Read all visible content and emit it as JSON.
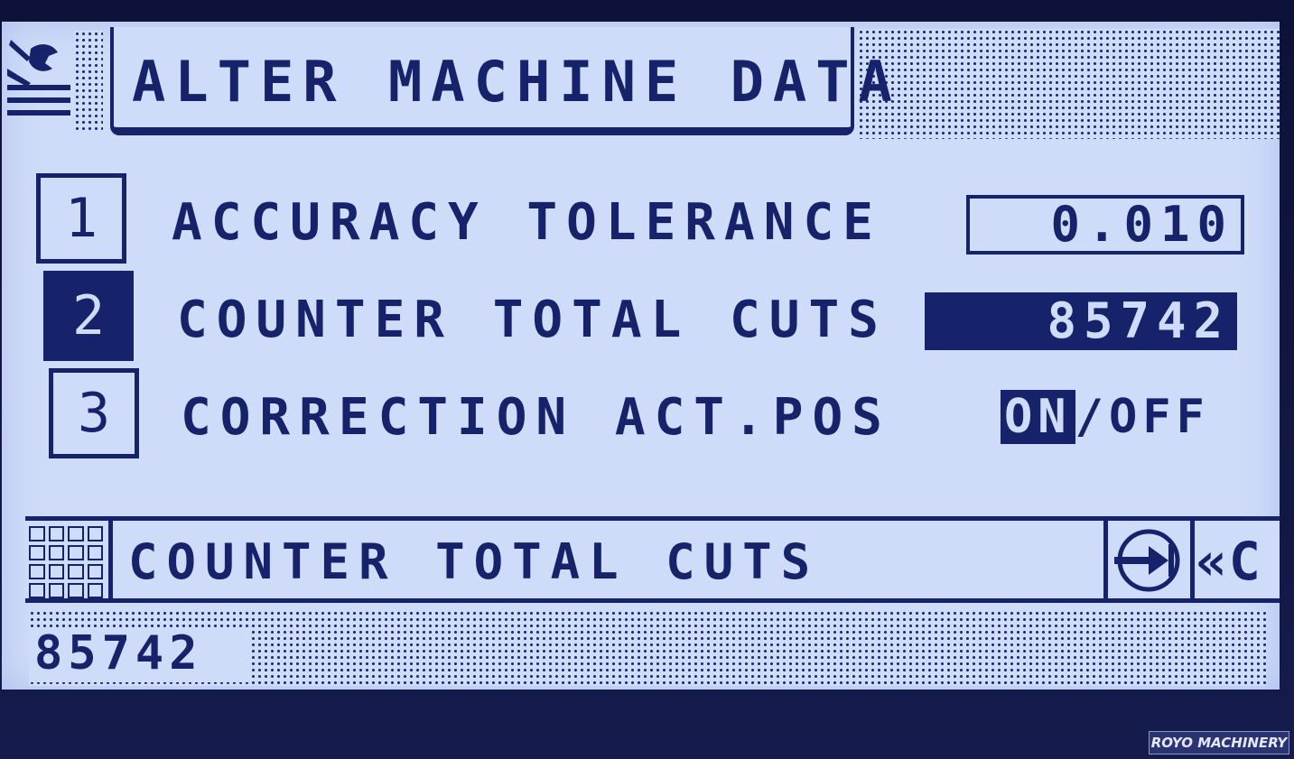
{
  "header": {
    "title": "ALTER MACHINE DATA",
    "icon": "wrench-icon"
  },
  "rows": [
    {
      "number": "1",
      "label": "ACCURACY TOLERANCE",
      "value": "0.010",
      "selected": false
    },
    {
      "number": "2",
      "label": "COUNTER TOTAL CUTS",
      "value": "85742",
      "selected": true
    },
    {
      "number": "3",
      "label": "CORRECTION ACT.POS",
      "on_label": "ON",
      "separator": "/",
      "off_label": "OFF",
      "state": "ON"
    }
  ],
  "status_bar": {
    "text": "COUNTER TOTAL CUTS",
    "keypad_icon": "keypad-icon",
    "enter_icon": "enter-icon",
    "back_label": "«C"
  },
  "entry": {
    "value": "85742"
  },
  "watermark": "ROYO MACHINERY",
  "colors": {
    "screen": "#cfdcf9",
    "ink": "#16226a",
    "bezel": "#10153f"
  }
}
